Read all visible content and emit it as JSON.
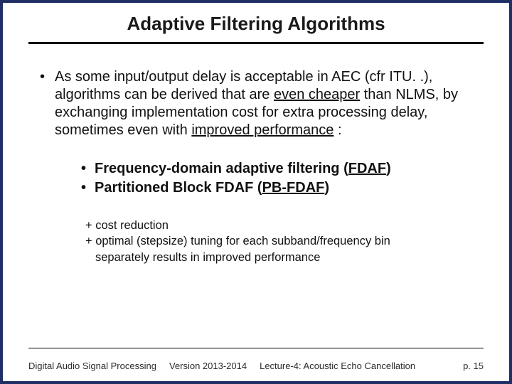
{
  "title": "Adaptive Filtering Algorithms",
  "bullet1": {
    "pre": "As some input/output delay is acceptable in AEC (cfr ITU. .), algorithms can be derived that are ",
    "u1": "even cheaper",
    "mid": " than NLMS, by exchanging implementation cost for extra processing delay, sometimes even with ",
    "u2": "improved performance",
    "post": " :"
  },
  "sub1": {
    "pre": "Frequency-domain adaptive filtering (",
    "u": "FDAF",
    "post": ")"
  },
  "sub2": {
    "pre": "Partitioned Block FDAF (",
    "u": "PB-FDAF",
    "post": ")"
  },
  "plus1": "+ cost reduction",
  "plus2a": "+ optimal (stepsize) tuning for each subband/frequency bin",
  "plus2b": "separately results in improved performance",
  "footer": {
    "course": "Digital Audio Signal Processing",
    "version": "Version 2013-2014",
    "lecture": "Lecture-4: Acoustic Echo Cancellation",
    "page": "p. 15"
  }
}
